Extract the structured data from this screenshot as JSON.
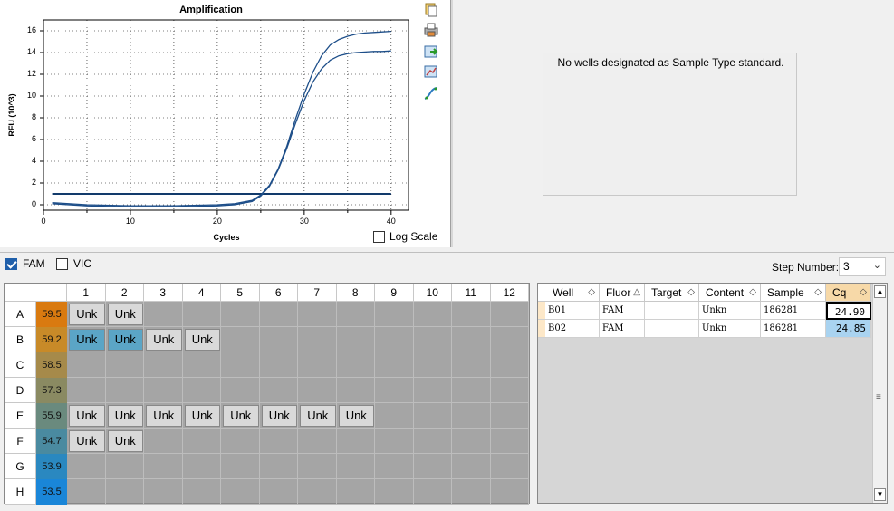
{
  "chart": {
    "title": "Amplification",
    "ylabel": "RFU (10^3)",
    "xlabel": "Cycles",
    "yticks": [
      "16",
      "14",
      "12",
      "10",
      "8",
      "6",
      "4",
      "2",
      "0"
    ],
    "xticks": [
      "0",
      "10",
      "20",
      "30",
      "40"
    ],
    "log_scale_label": "Log Scale"
  },
  "chart_data": {
    "type": "line",
    "title": "Amplification",
    "xlabel": "Cycles",
    "ylabel": "RFU (10^3)",
    "xlim": [
      0,
      42
    ],
    "ylim": [
      -0.5,
      17
    ],
    "grid": true,
    "threshold": 1.0,
    "series": [
      {
        "x": [
          1,
          5,
          10,
          15,
          20,
          22,
          24,
          25,
          26,
          27,
          28,
          29,
          30,
          31,
          32,
          33,
          34,
          35,
          36,
          37,
          38,
          39,
          40
        ],
        "values": [
          0.2,
          0.0,
          -0.1,
          -0.1,
          0.0,
          0.1,
          0.4,
          0.9,
          1.8,
          3.3,
          5.4,
          7.9,
          10.2,
          12.2,
          13.7,
          14.7,
          15.2,
          15.5,
          15.7,
          15.8,
          15.85,
          15.9,
          15.95
        ]
      },
      {
        "x": [
          1,
          5,
          10,
          15,
          20,
          22,
          24,
          25,
          26,
          27,
          28,
          29,
          30,
          31,
          32,
          33,
          34,
          35,
          36,
          37,
          38,
          39,
          40
        ],
        "values": [
          0.1,
          -0.1,
          -0.2,
          -0.2,
          -0.1,
          0.0,
          0.3,
          0.8,
          1.7,
          3.2,
          5.2,
          7.5,
          9.6,
          11.3,
          12.5,
          13.3,
          13.7,
          13.9,
          14.0,
          14.05,
          14.1,
          14.1,
          14.15
        ]
      }
    ]
  },
  "standard_panel": {
    "message": "No wells designated as Sample Type standard."
  },
  "fluors": [
    {
      "label": "FAM",
      "checked": true
    },
    {
      "label": "VIC",
      "checked": false
    }
  ],
  "step": {
    "label": "Step Number:",
    "value": "3"
  },
  "plate": {
    "columns": [
      "1",
      "2",
      "3",
      "4",
      "5",
      "6",
      "7",
      "8",
      "9",
      "10",
      "11",
      "12"
    ],
    "rows": [
      {
        "label": "A",
        "temp": "59.5",
        "color": "#d97a10",
        "wells": [
          1,
          2
        ],
        "selected": []
      },
      {
        "label": "B",
        "temp": "59.2",
        "color": "#c88a28",
        "wells": [
          1,
          2,
          3,
          4
        ],
        "selected": [
          1,
          2
        ]
      },
      {
        "label": "C",
        "temp": "58.5",
        "color": "#a68a4a",
        "wells": [],
        "selected": []
      },
      {
        "label": "D",
        "temp": "57.3",
        "color": "#8a8a62",
        "wells": [],
        "selected": []
      },
      {
        "label": "E",
        "temp": "55.9",
        "color": "#6a8a7e",
        "wells": [
          1,
          2,
          3,
          4,
          5,
          6,
          7,
          8
        ],
        "selected": []
      },
      {
        "label": "F",
        "temp": "54.7",
        "color": "#4a8aa0",
        "wells": [
          1,
          2
        ],
        "selected": []
      },
      {
        "label": "G",
        "temp": "53.9",
        "color": "#2a88c0",
        "wells": [],
        "selected": []
      },
      {
        "label": "H",
        "temp": "53.5",
        "color": "#1a86d8",
        "wells": [],
        "selected": []
      }
    ],
    "well_label": "Unk"
  },
  "table": {
    "headers": [
      "Well",
      "Fluor",
      "Target",
      "Content",
      "Sample",
      "Cq"
    ],
    "rows": [
      [
        "B01",
        "FAM",
        "",
        "Unkn",
        "186281",
        "24.90"
      ],
      [
        "B02",
        "FAM",
        "",
        "Unkn",
        "186281",
        "24.85"
      ]
    ]
  }
}
